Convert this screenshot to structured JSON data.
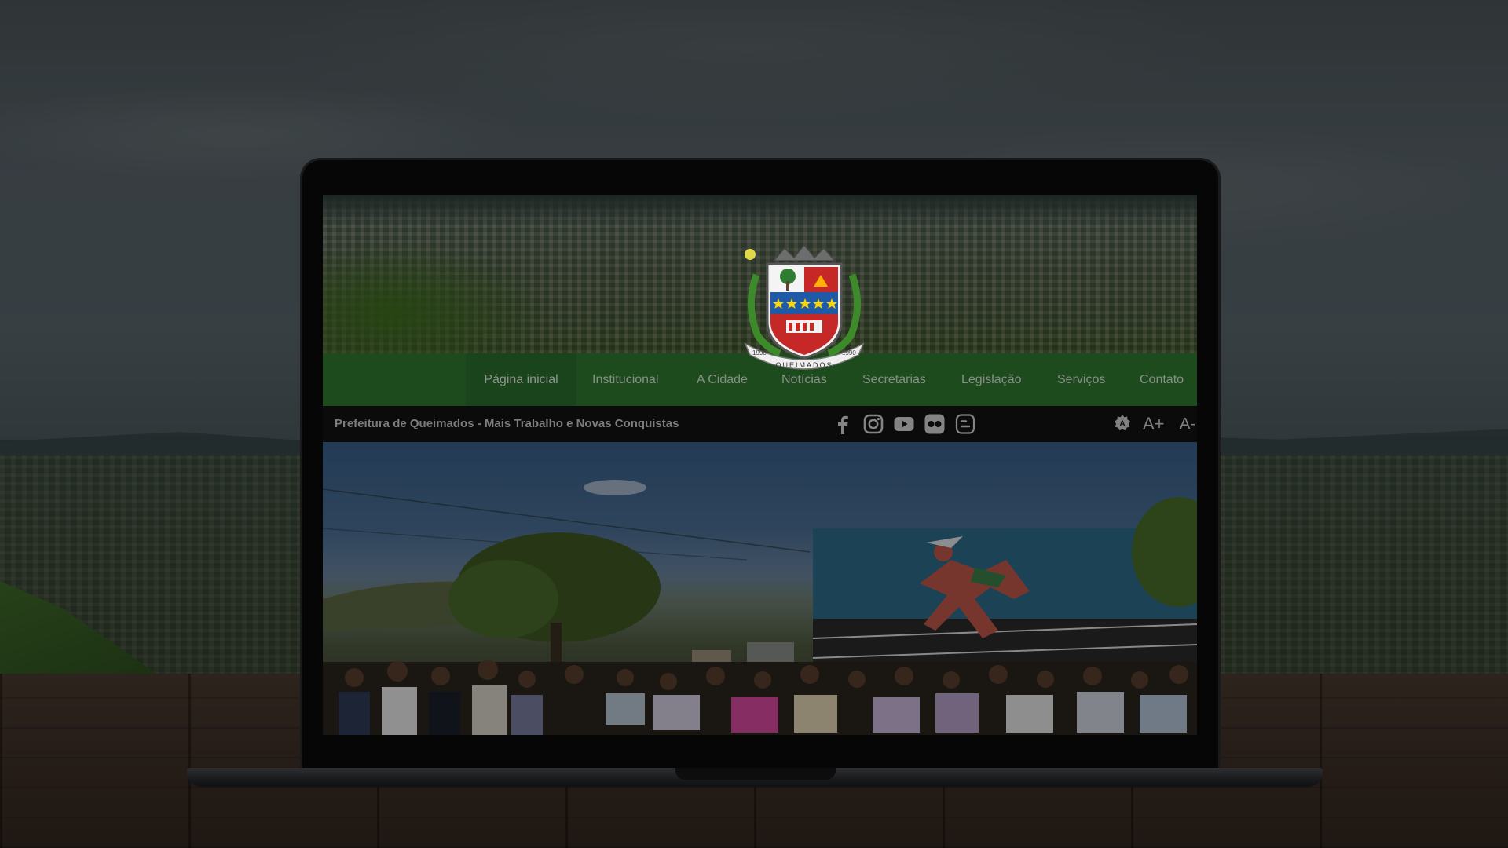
{
  "site": {
    "nav": [
      {
        "label": "Página inicial",
        "active": true
      },
      {
        "label": "Institucional"
      },
      {
        "label": "A Cidade"
      },
      {
        "label": "Notícias"
      },
      {
        "label": "Secretarias"
      },
      {
        "label": "Legislação"
      },
      {
        "label": "Serviços"
      },
      {
        "label": "Contato"
      }
    ],
    "tagline": "Prefeitura de Queimados - Mais Trabalho e Novas Conquistas",
    "social": [
      "facebook-icon",
      "instagram-icon",
      "youtube-icon",
      "flickr-icon",
      "blogger-icon"
    ],
    "accessibility": {
      "contrast_icon": "contrast-icon",
      "increase": "A+",
      "decrease": "A-"
    },
    "crest": {
      "motto": "QUEIMADOS",
      "year_left": "1990",
      "year_right": "1990"
    }
  },
  "colors": {
    "nav_green": "#2f7a31",
    "info_bar": "#121212",
    "crest_red": "#c62828",
    "crest_blue": "#1f5aa6",
    "star_yellow": "#ffd400"
  }
}
